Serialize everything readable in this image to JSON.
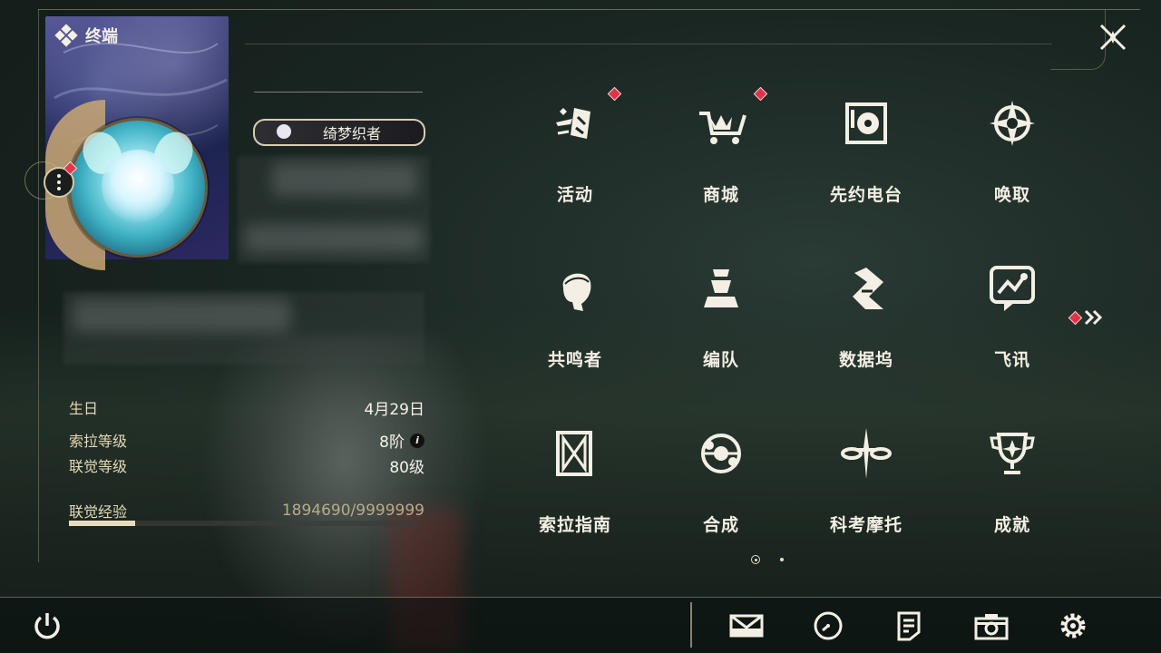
{
  "terminal": {
    "title": "终端"
  },
  "profile": {
    "title_badge": "绮梦织者",
    "info": [
      {
        "label": "生日",
        "value": "4月29日"
      },
      {
        "label": "索拉等级",
        "value": "8阶"
      },
      {
        "label": "联觉等级",
        "value": "80级"
      }
    ],
    "exp": {
      "label": "联觉经验",
      "value": "1894690/9999999",
      "progress": 0.189
    }
  },
  "menu": {
    "items": [
      {
        "label": "活动",
        "icon": "activity-icon",
        "has_notification": true
      },
      {
        "label": "商城",
        "icon": "shop-cart-icon",
        "has_notification": true
      },
      {
        "label": "先约电台",
        "icon": "radio-icon",
        "has_notification": false
      },
      {
        "label": "唤取",
        "icon": "compass-star-icon",
        "has_notification": false
      },
      {
        "label": "共鸣者",
        "icon": "resonator-head-icon",
        "has_notification": false
      },
      {
        "label": "编队",
        "icon": "chess-team-icon",
        "has_notification": false
      },
      {
        "label": "数据坞",
        "icon": "data-dock-icon",
        "has_notification": false
      },
      {
        "label": "飞讯",
        "icon": "message-bubble-icon",
        "has_notification": false
      },
      {
        "label": "索拉指南",
        "icon": "guide-icon",
        "has_notification": false
      },
      {
        "label": "合成",
        "icon": "synthesis-icon",
        "has_notification": false
      },
      {
        "label": "科考摩托",
        "icon": "motorbike-icon",
        "has_notification": false
      },
      {
        "label": "成就",
        "icon": "trophy-icon",
        "has_notification": false
      }
    ],
    "page_indicator": {
      "current": 1,
      "total": 2
    }
  },
  "bottom_bar": {
    "icons": [
      "power-icon",
      "mail-icon",
      "clock-icon",
      "notice-icon",
      "camera-icon",
      "settings-gear-icon"
    ]
  },
  "colors": {
    "accent": "#e8dcbf",
    "notification": "#dd3546",
    "background": "#1a2622"
  }
}
